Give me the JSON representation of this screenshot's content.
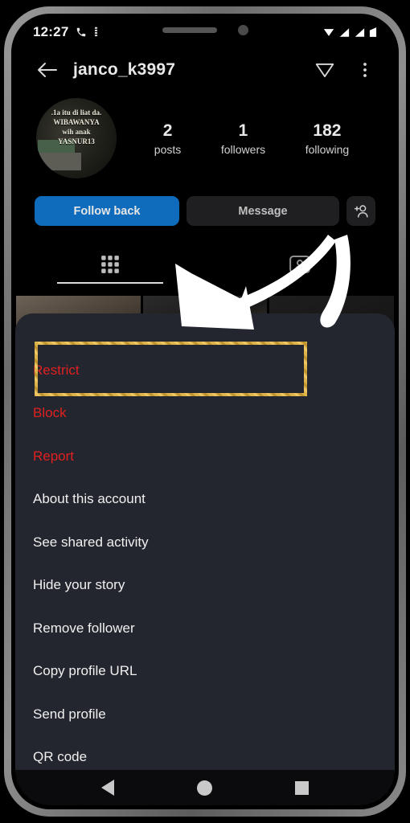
{
  "status_bar": {
    "time": "12:27",
    "icons": [
      "phone-call-icon",
      "vibrate-icon",
      "signal-icon",
      "wifi-icon",
      "network-icon",
      "battery-icon"
    ]
  },
  "header": {
    "back_icon": "back-arrow-icon",
    "username": "janco_k3997",
    "share_icon": "paper-plane-icon",
    "more_icon": "three-dot-menu-icon"
  },
  "profile": {
    "avatar_caption_lines": [
      ".1a itu di liat da.",
      "WIBAWANYA",
      "wih anak",
      "YASNUR13"
    ],
    "stats": [
      {
        "value": "2",
        "label": "posts"
      },
      {
        "value": "1",
        "label": "followers"
      },
      {
        "value": "182",
        "label": "following"
      }
    ],
    "actions": {
      "follow_back_label": "Follow back",
      "message_label": "Message",
      "add_person_icon": "add-person-icon"
    },
    "tabs": [
      {
        "name": "grid",
        "icon": "grid-icon",
        "active": true
      },
      {
        "name": "tagged",
        "icon": "tagged-person-icon",
        "active": false
      }
    ]
  },
  "options_sheet": {
    "items": [
      {
        "label": "Restrict",
        "style": "danger"
      },
      {
        "label": "Block",
        "style": "danger"
      },
      {
        "label": "Report",
        "style": "danger"
      },
      {
        "label": "About this account",
        "style": "normal"
      },
      {
        "label": "See shared activity",
        "style": "normal"
      },
      {
        "label": "Hide your story",
        "style": "normal"
      },
      {
        "label": "Remove follower",
        "style": "normal"
      },
      {
        "label": "Copy profile URL",
        "style": "normal"
      },
      {
        "label": "Send profile",
        "style": "normal"
      },
      {
        "label": "QR code",
        "style": "normal"
      }
    ]
  },
  "annotations": {
    "highlight_target": "Restrict",
    "highlight_color": "#d8a93c",
    "arrow_color": "#ffffff",
    "arrow_direction": "down-left"
  },
  "nav_bar": {
    "back_icon": "nav-back-triangle-icon",
    "home_icon": "nav-home-circle-icon",
    "recents_icon": "nav-recents-square-icon"
  },
  "colors": {
    "accent_blue": "#0f6cbd",
    "danger_red": "#e02020",
    "sheet_bg": "#23262e",
    "app_bg": "#000000"
  }
}
